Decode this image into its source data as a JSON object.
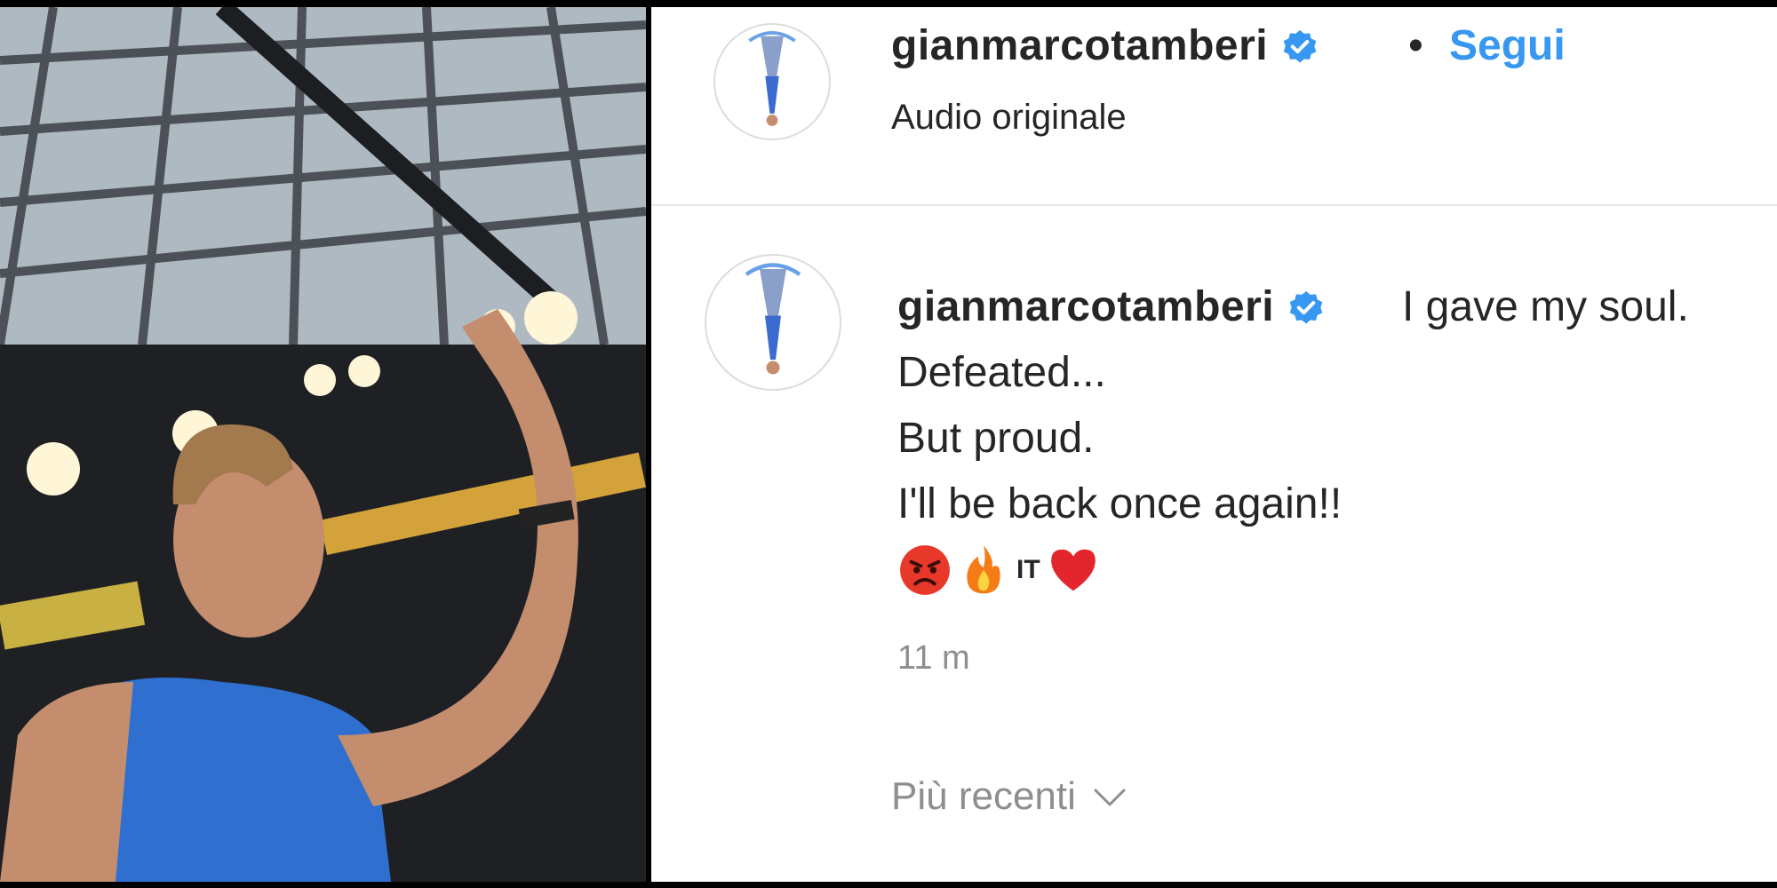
{
  "header": {
    "username": "gianmarcotamberi",
    "separator": "•",
    "follow_label": "Segui",
    "audio_label": "Audio originale"
  },
  "comment": {
    "username": "gianmarcotamberi",
    "lines": [
      "I gave my soul.",
      "Defeated...",
      "But proud.",
      "I'll be back once again!!"
    ],
    "emojis": [
      "angry-face",
      "fire",
      "flag-italy",
      "red-heart"
    ],
    "flag_text": "IT",
    "timestamp": "11 m"
  },
  "sort": {
    "label": "Più recenti"
  },
  "icons": {
    "verified": "verified-badge-icon",
    "chevron": "chevron-down-icon"
  },
  "colors": {
    "link_blue": "#3897f0",
    "text": "#262626",
    "muted": "#8e8e8e"
  }
}
